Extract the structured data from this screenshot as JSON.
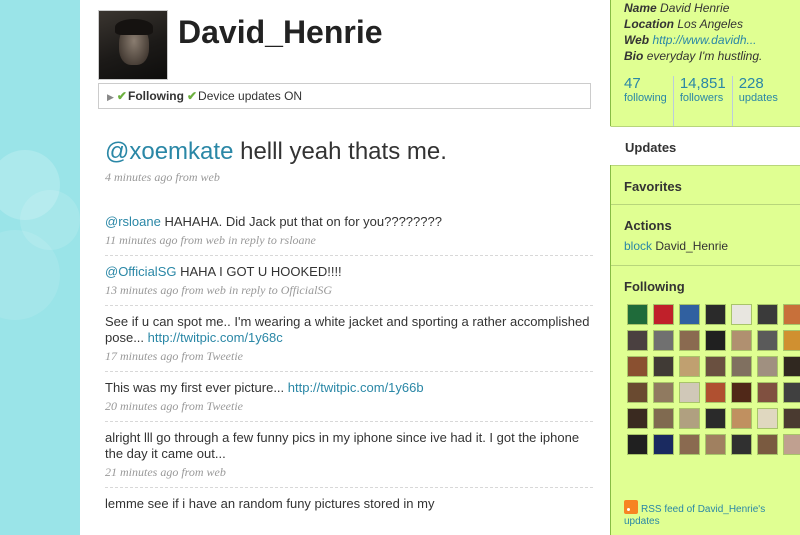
{
  "profile": {
    "username": "David_Henrie",
    "status_following": "Following",
    "status_device": "Device updates ON"
  },
  "latest_tweet": {
    "mention": "@xoemkate",
    "text": " helll yeah thats me.",
    "meta": "4 minutes ago from web"
  },
  "tweets": [
    {
      "mention": "@rsloane",
      "text": " HAHAHA. Did Jack put that on for you????????",
      "meta": "11 minutes ago from web in reply to rsloane"
    },
    {
      "mention": "@OfficialSG",
      "text": " HAHA I GOT U HOOKED!!!!",
      "meta": "13 minutes ago from web in reply to OfficialSG"
    },
    {
      "text": "See if u can spot me.. I'm wearing a white jacket and sporting a rather accomplished pose... ",
      "link": "http://twitpic.com/1y68c",
      "meta": "17 minutes ago from Tweetie"
    },
    {
      "text": "This was my first ever picture... ",
      "link": "http://twitpic.com/1y66b",
      "meta": "20 minutes ago from Tweetie"
    },
    {
      "text": "alright lll go through a few funny pics in my iphone since ive had it. I got the iphone the day it came out...",
      "meta": "21 minutes ago from web"
    },
    {
      "text": "lemme see if i have an random funy pictures stored in my",
      "meta": ""
    }
  ],
  "sidebar": {
    "info": {
      "name_label": "Name",
      "name_value": "David Henrie",
      "location_label": "Location",
      "location_value": "Los Angeles",
      "web_label": "Web",
      "web_value": "http://www.davidh...",
      "bio_label": "Bio",
      "bio_value": "everyday I'm hustling."
    },
    "stats": [
      {
        "num": "47",
        "label": "following"
      },
      {
        "num": "14,851",
        "label": "followers"
      },
      {
        "num": "228",
        "label": "updates"
      }
    ],
    "menu": {
      "updates": "Updates",
      "favorites": "Favorites"
    },
    "actions_title": "Actions",
    "actions_block": "block",
    "actions_block_user": "David_Henrie",
    "following_title": "Following",
    "rss_text": "RSS feed of David_Henrie's updates"
  },
  "following_thumb_colors": [
    "#1f6b3a",
    "#c0202a",
    "#3060a0",
    "#2a2a2a",
    "#e8e6e0",
    "#3a3a3a",
    "#c8703a",
    "#4a4040",
    "#707070",
    "#8a6a50",
    "#202020",
    "#b09070",
    "#5a5a5a",
    "#d09030",
    "#8a5030",
    "#403a35",
    "#c0a070",
    "#6a5040",
    "#807060",
    "#a09080",
    "#302820",
    "#6a4a30",
    "#907a60",
    "#d0c8b8",
    "#b05030",
    "#502818",
    "#805040",
    "#404040",
    "#3a2a20",
    "#806a50",
    "#b0a080",
    "#2a2a2a",
    "#c09060",
    "#e0d8c0",
    "#4a3a30",
    "#202020",
    "#1a2a60",
    "#8a6a50",
    "#a08060",
    "#303030",
    "#7a5a40",
    "#c0a090"
  ]
}
